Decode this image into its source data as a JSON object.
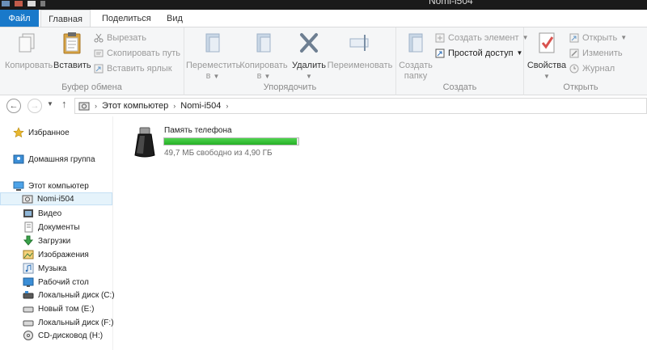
{
  "window": {
    "title": "Nomi-i504"
  },
  "tabs": {
    "file": "Файл",
    "home": "Главная",
    "share": "Поделиться",
    "view": "Вид"
  },
  "ribbon": {
    "clipboard": {
      "copy": "Копировать",
      "paste": "Вставить",
      "cut": "Вырезать",
      "copy_path": "Скопировать путь",
      "paste_shortcut": "Вставить ярлык",
      "label": "Буфер обмена"
    },
    "organize": {
      "move_line1": "Переместить",
      "move_line2": "в",
      "copy_to_line1": "Копировать",
      "copy_to_line2": "в",
      "delete": "Удалить",
      "rename": "Переименовать",
      "label": "Упорядочить"
    },
    "create": {
      "new_folder_line1": "Создать",
      "new_folder_line2": "папку",
      "new_item": "Создать элемент",
      "easy_access": "Простой доступ",
      "label": "Создать"
    },
    "open": {
      "properties": "Свойства",
      "open": "Открыть",
      "edit": "Изменить",
      "history": "Журнал",
      "label": "Открыть"
    }
  },
  "address": {
    "crumbs": [
      "Этот компьютер",
      "Nomi-i504"
    ]
  },
  "nav": {
    "favorites": "Избранное",
    "homegroup": "Домашняя группа",
    "this_pc": "Этот компьютер",
    "items": [
      "Nomi-i504",
      "Видео",
      "Документы",
      "Загрузки",
      "Изображения",
      "Музыка",
      "Рабочий стол",
      "Локальный диск (C:)",
      "Новый том (E:)",
      "Локальный диск (F:)",
      "CD-дисковод (H:)"
    ]
  },
  "content": {
    "device_name": "Память телефона",
    "free_space": "49,7 МБ свободно из 4,90 ГБ",
    "used_fraction": 0.99
  },
  "colors": {
    "accent": "#1979ca",
    "progress": "#26b026",
    "selected_bg": "#e5f3fb"
  }
}
